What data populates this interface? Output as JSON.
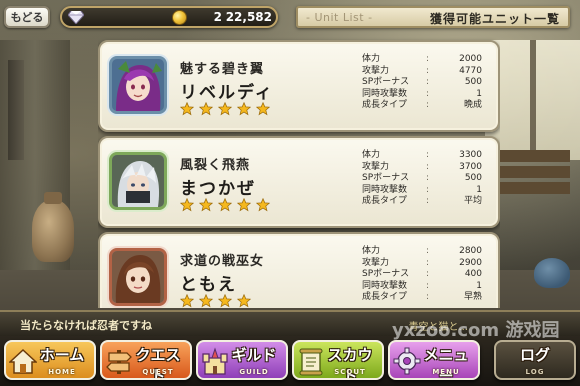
{
  "header": {
    "back_label": "もどる",
    "gems": "2",
    "coins": "22,582",
    "title_en": "- Unit List -",
    "title_ja": "獲得可能ユニット一覧"
  },
  "units": [
    {
      "title": "魅する碧き翼",
      "name": "リベルディ",
      "stars": 5,
      "element": "blue",
      "stats": [
        {
          "label": "体力",
          "value": "2000"
        },
        {
          "label": "攻撃力",
          "value": "4770"
        },
        {
          "label": "SPボーナス",
          "value": "500"
        },
        {
          "label": "同時攻撃数",
          "value": "1"
        },
        {
          "label": "成長タイプ",
          "value": "晩成"
        }
      ]
    },
    {
      "title": "風裂く飛燕",
      "name": "まつかぜ",
      "stars": 5,
      "element": "green",
      "stats": [
        {
          "label": "体力",
          "value": "3300"
        },
        {
          "label": "攻撃力",
          "value": "3700"
        },
        {
          "label": "SPボーナス",
          "value": "500"
        },
        {
          "label": "同時攻撃数",
          "value": "1"
        },
        {
          "label": "成長タイプ",
          "value": "平均"
        }
      ]
    },
    {
      "title": "求道の戦巫女",
      "name": "ともえ",
      "stars": 4,
      "element": "red",
      "stats": [
        {
          "label": "体力",
          "value": "2800"
        },
        {
          "label": "攻撃力",
          "value": "2900"
        },
        {
          "label": "SPボーナス",
          "value": "400"
        },
        {
          "label": "同時攻撃数",
          "value": "1"
        },
        {
          "label": "成長タイプ",
          "value": "早熟"
        }
      ]
    }
  ],
  "message": {
    "text": "当たらなければ忍者ですね",
    "sub": "青空と猫と..."
  },
  "nav": {
    "home": {
      "label": "ホーム",
      "sub": "HOME"
    },
    "quest": {
      "label": "クエスト",
      "sub": "QUEST"
    },
    "guild": {
      "label": "ギルド",
      "sub": "GUILD"
    },
    "scout": {
      "label": "スカウト",
      "sub": "SCOUT"
    },
    "menu": {
      "label": "メニュー",
      "sub": "MENU"
    },
    "log": {
      "label": "ログ",
      "sub": "LOG"
    }
  },
  "watermark": "yxzoo.com 游戏园"
}
